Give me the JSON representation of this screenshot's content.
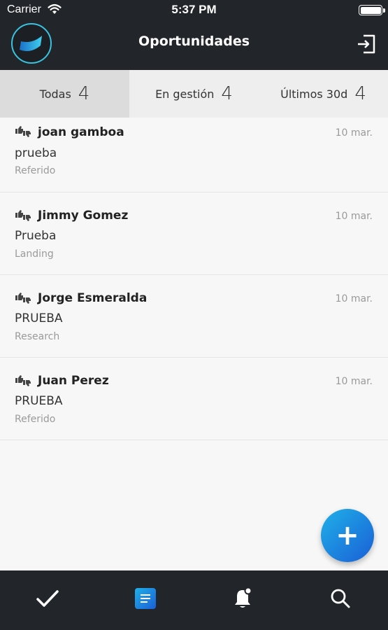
{
  "status_bar": {
    "carrier": "Carrier",
    "time": "5:37 PM",
    "wifi_icon": "wifi-icon",
    "battery_icon": "battery-full-icon"
  },
  "header": {
    "title": "Oportunidades",
    "logo_icon": "app-logo",
    "logout_icon": "logout-icon"
  },
  "tabs": [
    {
      "label": "Todas",
      "count": "4",
      "active": true
    },
    {
      "label": "En gestión",
      "count": "4",
      "active": false
    },
    {
      "label": "Últimos 30d",
      "count": "4",
      "active": false
    }
  ],
  "opportunities": [
    {
      "name": "joan gamboa",
      "date": "10 mar.",
      "description": "prueba",
      "source": "Referido"
    },
    {
      "name": "Jimmy Gomez",
      "date": "10 mar.",
      "description": "Prueba",
      "source": "Landing"
    },
    {
      "name": "Jorge Esmeralda",
      "date": "10 mar.",
      "description": "PRUEBA",
      "source": "Research"
    },
    {
      "name": "Juan Perez",
      "date": "10 mar.",
      "description": "PRUEBA",
      "source": "Referido"
    }
  ],
  "fab": {
    "label": "+",
    "icon": "plus-icon"
  },
  "bottom_tabs": [
    {
      "icon": "check-icon"
    },
    {
      "icon": "list-icon",
      "active": true
    },
    {
      "icon": "bell-icon"
    },
    {
      "icon": "search-icon"
    }
  ],
  "colors": {
    "bar_bg": "#22262a",
    "accent": "#1fb0e8",
    "active_tab": "#dcdcdc"
  }
}
